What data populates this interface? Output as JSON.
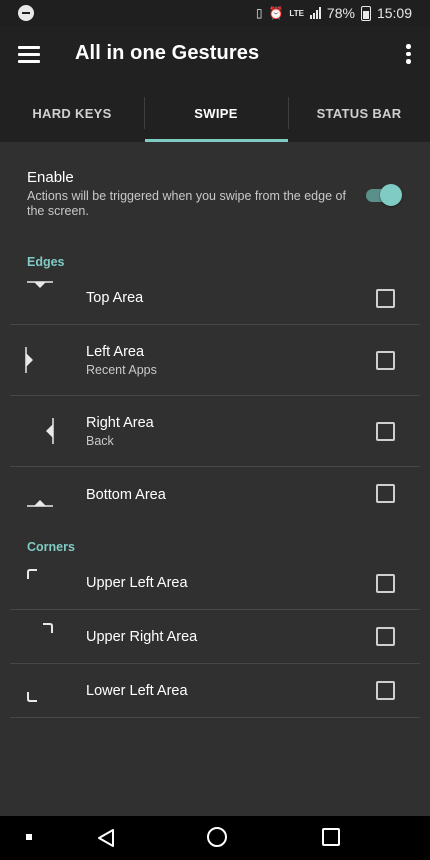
{
  "status_bar": {
    "network": "LTE",
    "battery": "78%",
    "time": "15:09"
  },
  "app_bar": {
    "title": "All in one Gestures"
  },
  "tabs": [
    {
      "label": "HARD KEYS",
      "selected": false
    },
    {
      "label": "SWIPE",
      "selected": true
    },
    {
      "label": "STATUS BAR",
      "selected": false
    }
  ],
  "enable": {
    "title": "Enable",
    "description": "Actions will be triggered when you swipe from the edge of the screen.",
    "on": true
  },
  "sections": {
    "edges": {
      "header": "Edges",
      "items": [
        {
          "label": "Top Area",
          "subtitle": "",
          "checked": false
        },
        {
          "label": "Left Area",
          "subtitle": "Recent Apps",
          "checked": false
        },
        {
          "label": "Right Area",
          "subtitle": "Back",
          "checked": false
        },
        {
          "label": "Bottom Area",
          "subtitle": "",
          "checked": false
        }
      ]
    },
    "corners": {
      "header": "Corners",
      "items": [
        {
          "label": "Upper Left Area",
          "subtitle": "",
          "checked": false
        },
        {
          "label": "Upper Right Area",
          "subtitle": "",
          "checked": false
        },
        {
          "label": "Lower Left Area",
          "subtitle": "",
          "checked": false
        }
      ]
    }
  },
  "colors": {
    "accent": "#80cbc4",
    "background": "#303030",
    "toolbar": "#212121"
  }
}
